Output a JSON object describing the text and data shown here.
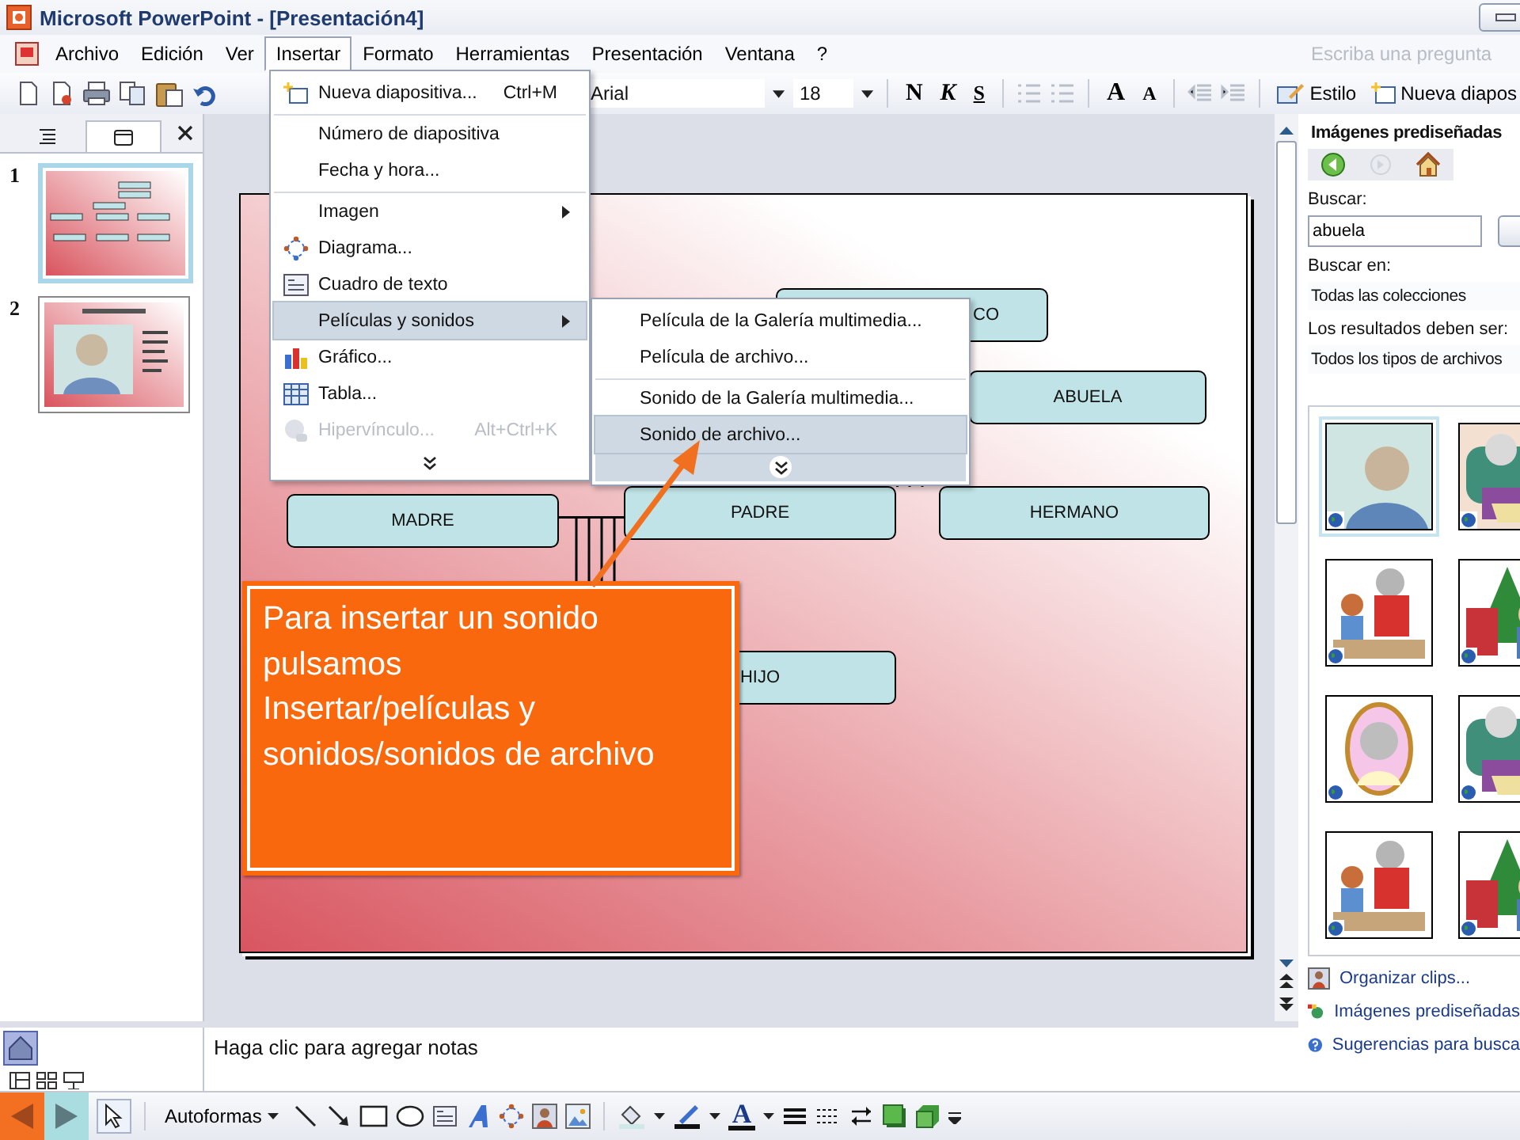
{
  "window": {
    "title": "Microsoft PowerPoint - [Presentación4]"
  },
  "menu_bar": {
    "items": [
      {
        "label": "Archivo",
        "selected": false
      },
      {
        "label": "Edición",
        "selected": false
      },
      {
        "label": "Ver",
        "selected": false
      },
      {
        "label": "Insertar",
        "selected": true
      },
      {
        "label": "Formato",
        "selected": false
      },
      {
        "label": "Herramientas",
        "selected": false
      },
      {
        "label": "Presentación",
        "selected": false
      },
      {
        "label": "Ventana",
        "selected": false
      },
      {
        "label": "?",
        "selected": false
      }
    ],
    "help_placeholder": "Escriba una pregunta"
  },
  "toolbar": {
    "font": "Arial",
    "size": "18",
    "bold": "N",
    "italic": "K",
    "underline": "S",
    "grow_font": "A",
    "shrink_font": "A",
    "buttons": [
      "Estilo",
      "Nueva diapos"
    ]
  },
  "slides_pane": {
    "tabs": [
      {
        "selected": false
      },
      {
        "selected": true
      }
    ],
    "thumbnails": [
      {
        "number": "1",
        "selected": true
      },
      {
        "number": "2",
        "selected": false
      }
    ]
  },
  "slide": {
    "nodes": [
      {
        "label": "CO"
      },
      {
        "label": "ABUELA"
      },
      {
        "label": "MADRE"
      },
      {
        "label": "PADRE"
      },
      {
        "label": "HERMANO"
      },
      {
        "label": "HIJO"
      }
    ]
  },
  "insert_menu": {
    "items": [
      {
        "label": "Nueva diapositiva...",
        "shortcut": "Ctrl+M",
        "separator": false,
        "submenu": false,
        "selected": false,
        "disabled": false
      },
      {
        "label": "Número de diapositiva",
        "separator": true,
        "submenu": false,
        "selected": false,
        "disabled": false
      },
      {
        "label": "Fecha y hora...",
        "separator": false,
        "submenu": false,
        "selected": false,
        "disabled": false
      },
      {
        "label": "Imagen",
        "separator": true,
        "submenu": true,
        "selected": false,
        "disabled": false
      },
      {
        "label": "Diagrama...",
        "separator": false,
        "submenu": false,
        "selected": false,
        "disabled": false
      },
      {
        "label": "Cuadro de texto",
        "separator": false,
        "submenu": false,
        "selected": false,
        "disabled": false
      },
      {
        "label": "Películas y sonidos",
        "separator": false,
        "submenu": true,
        "selected": true,
        "disabled": false
      },
      {
        "label": "Gráfico...",
        "separator": false,
        "submenu": false,
        "selected": false,
        "disabled": false
      },
      {
        "label": "Tabla...",
        "separator": false,
        "submenu": false,
        "selected": false,
        "disabled": false
      },
      {
        "label": "Hipervínculo...",
        "shortcut": "Alt+Ctrl+K",
        "separator": false,
        "submenu": false,
        "selected": false,
        "disabled": true
      }
    ]
  },
  "submenu": {
    "items": [
      {
        "label": "Película de la Galería multimedia...",
        "separator": false,
        "selected": false
      },
      {
        "label": "Película de archivo...",
        "separator": false,
        "selected": false
      },
      {
        "label": "Sonido de la Galería multimedia...",
        "separator": true,
        "selected": false
      },
      {
        "label": "Sonido de archivo...",
        "separator": false,
        "selected": true
      }
    ]
  },
  "callout": {
    "lines": [
      "Para insertar un sonido",
      "pulsamos",
      "Insertar/películas y",
      "sonidos/sonidos de archivo"
    ]
  },
  "task_pane": {
    "title": "Imágenes prediseñadas",
    "search_label": "Buscar:",
    "search_value": "abuela",
    "search_in_label": "Buscar en:",
    "search_in_value": "Todas las colecciones",
    "results_label": "Los resultados deben ser:",
    "results_value": "Todos los tipos de archivos",
    "clips": [
      {
        "kind": "picture",
        "selected": true
      },
      {
        "kind": "picture",
        "selected": false
      },
      {
        "kind": "picture",
        "selected": false
      },
      {
        "kind": "picture",
        "selected": false
      },
      {
        "kind": "picture",
        "selected": false
      },
      {
        "kind": "picture",
        "selected": false
      },
      {
        "kind": "picture",
        "selected": false
      },
      {
        "kind": "picture",
        "selected": false
      }
    ],
    "links": [
      "Organizar clips...",
      "Imágenes prediseñadas",
      "Sugerencias para busca"
    ]
  },
  "notes": {
    "placeholder": "Haga clic para agregar notas"
  },
  "drawing_toolbar": {
    "autoshapes": "Autoformas",
    "font_color": "A"
  }
}
